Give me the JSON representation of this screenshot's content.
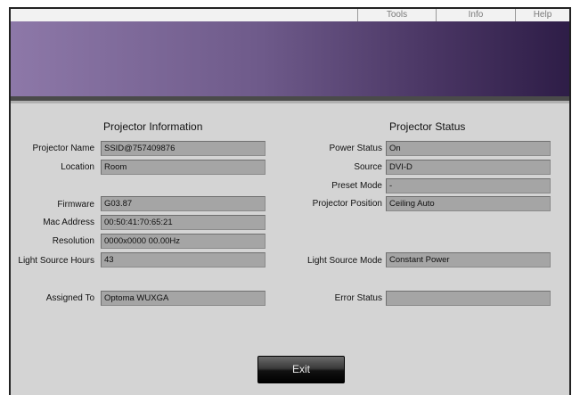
{
  "menu": {
    "tools": "Tools",
    "info": "Info",
    "help": "Help"
  },
  "info": {
    "title": "Projector Information",
    "projector_name": {
      "label": "Projector Name",
      "value": "SSID@757409876"
    },
    "location": {
      "label": "Location",
      "value": "Room"
    },
    "firmware": {
      "label": "Firmware",
      "value": "G03.87"
    },
    "mac_address": {
      "label": "Mac Address",
      "value": "00:50:41:70:65:21"
    },
    "resolution": {
      "label": "Resolution",
      "value": "0000x0000  00.00Hz"
    },
    "light_source_hours": {
      "label": "Light Source Hours",
      "value": "43"
    },
    "assigned_to": {
      "label": "Assigned To",
      "value": "Optoma WUXGA"
    }
  },
  "status": {
    "title": "Projector Status",
    "power_status": {
      "label": "Power Status",
      "value": "On"
    },
    "source": {
      "label": "Source",
      "value": "DVI-D"
    },
    "preset_mode": {
      "label": "Preset Mode",
      "value": "-"
    },
    "projector_position": {
      "label": "Projector Position",
      "value": "Ceiling Auto"
    },
    "light_source_mode": {
      "label": "Light Source Mode",
      "value": "Constant Power"
    },
    "error_status": {
      "label": "Error Status",
      "value": ""
    }
  },
  "exit_label": "Exit",
  "colors": {
    "banner_start": "#8d78a8",
    "banner_end": "#2e1d47",
    "panel": "#d4d4d4",
    "field": "#a5a5a5"
  }
}
